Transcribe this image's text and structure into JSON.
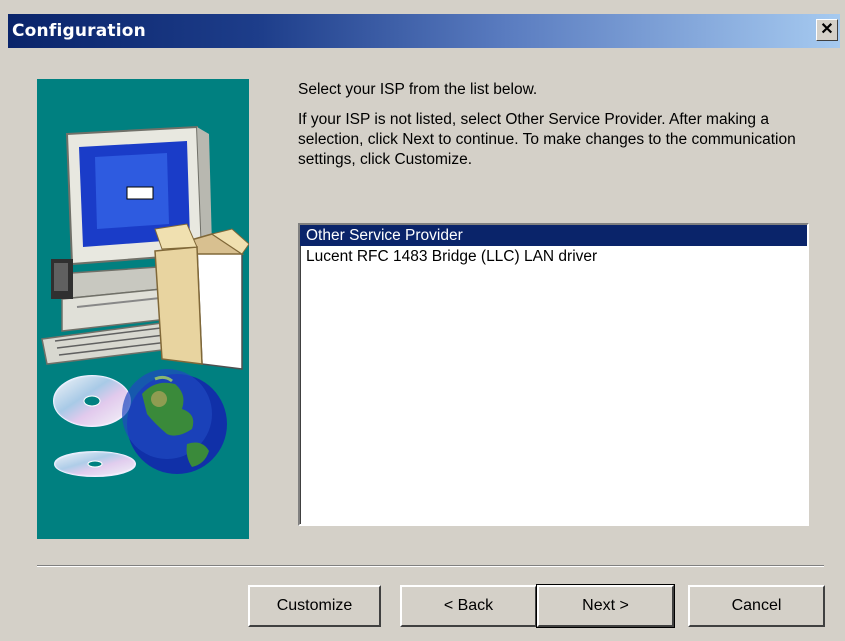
{
  "window": {
    "title": "Configuration",
    "close_label": "✕"
  },
  "instructions": {
    "line1": "Select your ISP from the list below.",
    "line2": "If your ISP is not listed, select Other Service Provider.  After making a selection, click Next to continue.  To make changes to the communication settings, click Customize."
  },
  "isp_list": {
    "items": [
      {
        "label": "Other Service Provider",
        "selected": true
      },
      {
        "label": "Lucent RFC 1483 Bridge (LLC) LAN driver",
        "selected": false
      }
    ]
  },
  "buttons": {
    "customize": "Customize",
    "back": "< Back",
    "next": "Next >",
    "cancel": "Cancel"
  },
  "colors": {
    "title_start": "#0a246a",
    "title_end": "#a6caf0",
    "panel_bg": "#008080",
    "selection": "#0a246a",
    "dialog_bg": "#d4d0c8"
  },
  "illustration": {
    "icons": [
      "computer-icon",
      "cd-icon",
      "globe-icon"
    ]
  }
}
